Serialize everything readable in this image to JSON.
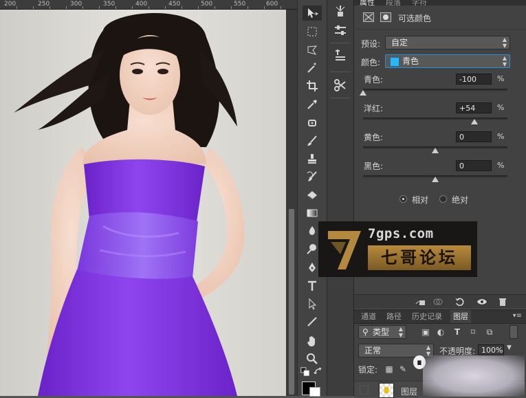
{
  "ruler": {
    "labels": [
      "200",
      "250",
      "300",
      "350",
      "400",
      "450",
      "500",
      "550",
      "600"
    ]
  },
  "properties": {
    "tabs": [
      "属性",
      "段落",
      "字符"
    ],
    "title": "可选颜色",
    "preset_label": "预设:",
    "preset_value": "自定",
    "colors_label": "颜色:",
    "colors_value": "青色",
    "colors_swatch": "#2db5f5",
    "sliders": [
      {
        "label": "青色:",
        "value": "-100",
        "unit": "%",
        "level": -100
      },
      {
        "label": "洋红:",
        "value": "+54",
        "unit": "%",
        "level": 54
      },
      {
        "label": "黄色:",
        "value": "0",
        "unit": "%",
        "level": 0
      },
      {
        "label": "黑色:",
        "value": "0",
        "unit": "%",
        "level": 0
      }
    ],
    "method_relative": "相对",
    "method_absolute": "绝对",
    "method_selected": "relative"
  },
  "layers": {
    "tabs": [
      "通道",
      "路径",
      "历史记录",
      "图层"
    ],
    "active_tab": "图层",
    "filter_label": "类型",
    "blend_mode": "正常",
    "opacity_label": "不透明度:",
    "opacity_value": "100%",
    "lock_label": "锁定:",
    "layer_name": "图层"
  },
  "watermark": {
    "domain": "7gps.com",
    "title": "七哥论坛"
  },
  "colors": {
    "dress": "#8a3fe6",
    "panel": "#424242",
    "accent": "#2db5f5"
  }
}
